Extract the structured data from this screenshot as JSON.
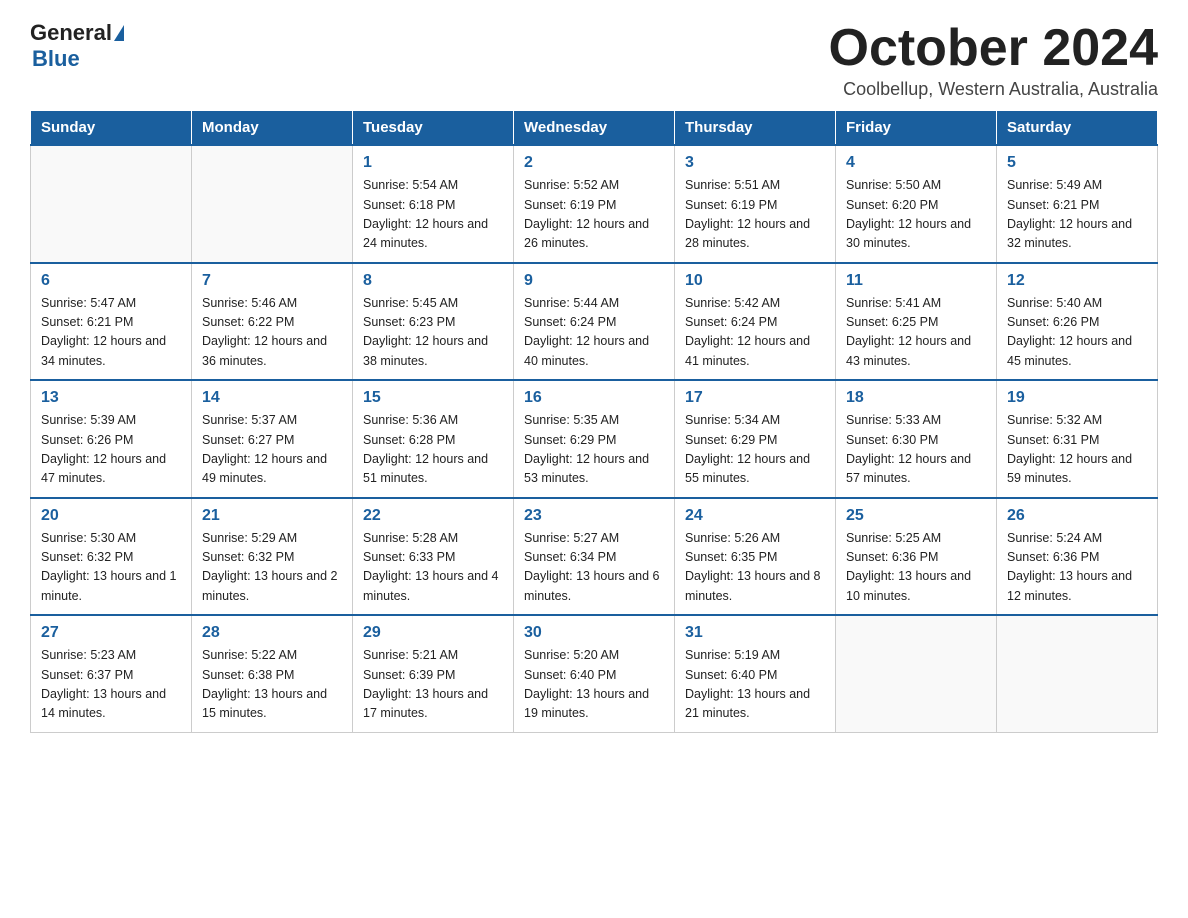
{
  "logo": {
    "general": "General",
    "triangle": "",
    "blue": "Blue"
  },
  "title": "October 2024",
  "subtitle": "Coolbellup, Western Australia, Australia",
  "days_of_week": [
    "Sunday",
    "Monday",
    "Tuesday",
    "Wednesday",
    "Thursday",
    "Friday",
    "Saturday"
  ],
  "weeks": [
    [
      {
        "day": "",
        "sunrise": "",
        "sunset": "",
        "daylight": ""
      },
      {
        "day": "",
        "sunrise": "",
        "sunset": "",
        "daylight": ""
      },
      {
        "day": "1",
        "sunrise": "Sunrise: 5:54 AM",
        "sunset": "Sunset: 6:18 PM",
        "daylight": "Daylight: 12 hours and 24 minutes."
      },
      {
        "day": "2",
        "sunrise": "Sunrise: 5:52 AM",
        "sunset": "Sunset: 6:19 PM",
        "daylight": "Daylight: 12 hours and 26 minutes."
      },
      {
        "day": "3",
        "sunrise": "Sunrise: 5:51 AM",
        "sunset": "Sunset: 6:19 PM",
        "daylight": "Daylight: 12 hours and 28 minutes."
      },
      {
        "day": "4",
        "sunrise": "Sunrise: 5:50 AM",
        "sunset": "Sunset: 6:20 PM",
        "daylight": "Daylight: 12 hours and 30 minutes."
      },
      {
        "day": "5",
        "sunrise": "Sunrise: 5:49 AM",
        "sunset": "Sunset: 6:21 PM",
        "daylight": "Daylight: 12 hours and 32 minutes."
      }
    ],
    [
      {
        "day": "6",
        "sunrise": "Sunrise: 5:47 AM",
        "sunset": "Sunset: 6:21 PM",
        "daylight": "Daylight: 12 hours and 34 minutes."
      },
      {
        "day": "7",
        "sunrise": "Sunrise: 5:46 AM",
        "sunset": "Sunset: 6:22 PM",
        "daylight": "Daylight: 12 hours and 36 minutes."
      },
      {
        "day": "8",
        "sunrise": "Sunrise: 5:45 AM",
        "sunset": "Sunset: 6:23 PM",
        "daylight": "Daylight: 12 hours and 38 minutes."
      },
      {
        "day": "9",
        "sunrise": "Sunrise: 5:44 AM",
        "sunset": "Sunset: 6:24 PM",
        "daylight": "Daylight: 12 hours and 40 minutes."
      },
      {
        "day": "10",
        "sunrise": "Sunrise: 5:42 AM",
        "sunset": "Sunset: 6:24 PM",
        "daylight": "Daylight: 12 hours and 41 minutes."
      },
      {
        "day": "11",
        "sunrise": "Sunrise: 5:41 AM",
        "sunset": "Sunset: 6:25 PM",
        "daylight": "Daylight: 12 hours and 43 minutes."
      },
      {
        "day": "12",
        "sunrise": "Sunrise: 5:40 AM",
        "sunset": "Sunset: 6:26 PM",
        "daylight": "Daylight: 12 hours and 45 minutes."
      }
    ],
    [
      {
        "day": "13",
        "sunrise": "Sunrise: 5:39 AM",
        "sunset": "Sunset: 6:26 PM",
        "daylight": "Daylight: 12 hours and 47 minutes."
      },
      {
        "day": "14",
        "sunrise": "Sunrise: 5:37 AM",
        "sunset": "Sunset: 6:27 PM",
        "daylight": "Daylight: 12 hours and 49 minutes."
      },
      {
        "day": "15",
        "sunrise": "Sunrise: 5:36 AM",
        "sunset": "Sunset: 6:28 PM",
        "daylight": "Daylight: 12 hours and 51 minutes."
      },
      {
        "day": "16",
        "sunrise": "Sunrise: 5:35 AM",
        "sunset": "Sunset: 6:29 PM",
        "daylight": "Daylight: 12 hours and 53 minutes."
      },
      {
        "day": "17",
        "sunrise": "Sunrise: 5:34 AM",
        "sunset": "Sunset: 6:29 PM",
        "daylight": "Daylight: 12 hours and 55 minutes."
      },
      {
        "day": "18",
        "sunrise": "Sunrise: 5:33 AM",
        "sunset": "Sunset: 6:30 PM",
        "daylight": "Daylight: 12 hours and 57 minutes."
      },
      {
        "day": "19",
        "sunrise": "Sunrise: 5:32 AM",
        "sunset": "Sunset: 6:31 PM",
        "daylight": "Daylight: 12 hours and 59 minutes."
      }
    ],
    [
      {
        "day": "20",
        "sunrise": "Sunrise: 5:30 AM",
        "sunset": "Sunset: 6:32 PM",
        "daylight": "Daylight: 13 hours and 1 minute."
      },
      {
        "day": "21",
        "sunrise": "Sunrise: 5:29 AM",
        "sunset": "Sunset: 6:32 PM",
        "daylight": "Daylight: 13 hours and 2 minutes."
      },
      {
        "day": "22",
        "sunrise": "Sunrise: 5:28 AM",
        "sunset": "Sunset: 6:33 PM",
        "daylight": "Daylight: 13 hours and 4 minutes."
      },
      {
        "day": "23",
        "sunrise": "Sunrise: 5:27 AM",
        "sunset": "Sunset: 6:34 PM",
        "daylight": "Daylight: 13 hours and 6 minutes."
      },
      {
        "day": "24",
        "sunrise": "Sunrise: 5:26 AM",
        "sunset": "Sunset: 6:35 PM",
        "daylight": "Daylight: 13 hours and 8 minutes."
      },
      {
        "day": "25",
        "sunrise": "Sunrise: 5:25 AM",
        "sunset": "Sunset: 6:36 PM",
        "daylight": "Daylight: 13 hours and 10 minutes."
      },
      {
        "day": "26",
        "sunrise": "Sunrise: 5:24 AM",
        "sunset": "Sunset: 6:36 PM",
        "daylight": "Daylight: 13 hours and 12 minutes."
      }
    ],
    [
      {
        "day": "27",
        "sunrise": "Sunrise: 5:23 AM",
        "sunset": "Sunset: 6:37 PM",
        "daylight": "Daylight: 13 hours and 14 minutes."
      },
      {
        "day": "28",
        "sunrise": "Sunrise: 5:22 AM",
        "sunset": "Sunset: 6:38 PM",
        "daylight": "Daylight: 13 hours and 15 minutes."
      },
      {
        "day": "29",
        "sunrise": "Sunrise: 5:21 AM",
        "sunset": "Sunset: 6:39 PM",
        "daylight": "Daylight: 13 hours and 17 minutes."
      },
      {
        "day": "30",
        "sunrise": "Sunrise: 5:20 AM",
        "sunset": "Sunset: 6:40 PM",
        "daylight": "Daylight: 13 hours and 19 minutes."
      },
      {
        "day": "31",
        "sunrise": "Sunrise: 5:19 AM",
        "sunset": "Sunset: 6:40 PM",
        "daylight": "Daylight: 13 hours and 21 minutes."
      },
      {
        "day": "",
        "sunrise": "",
        "sunset": "",
        "daylight": ""
      },
      {
        "day": "",
        "sunrise": "",
        "sunset": "",
        "daylight": ""
      }
    ]
  ]
}
